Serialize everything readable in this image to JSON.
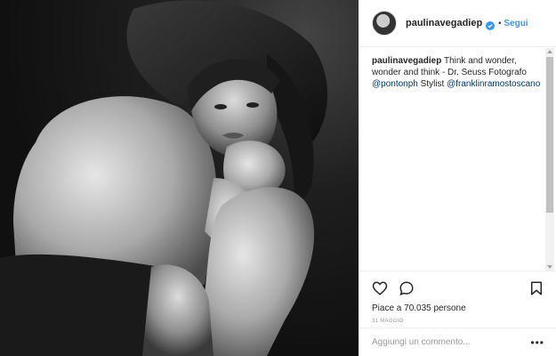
{
  "post": {
    "username": "paulinavegadiep",
    "follow_label": "Segui",
    "dot": "•",
    "caption": {
      "author": "paulinavegadiep",
      "text": " Think and wonder, wonder and think - Dr. Seuss Fotografo ",
      "mention1": "@pontonph",
      "middle": " Stylist ",
      "mention2": "@franklinramostoscano"
    },
    "likes": "Piace a 70.035 persone",
    "date": "31 maggio",
    "comment_placeholder": "Aggiungi un commento...",
    "more_label": "•••"
  },
  "icons": {
    "like": "heart-icon",
    "comment": "comment-icon",
    "save": "bookmark-icon",
    "verified": "verified-badge-icon",
    "more": "more-options-icon"
  },
  "colors": {
    "accent": "#3897f0",
    "text": "#262626",
    "muted": "#999999",
    "mention": "#003569",
    "photo_bg": "#161616"
  }
}
